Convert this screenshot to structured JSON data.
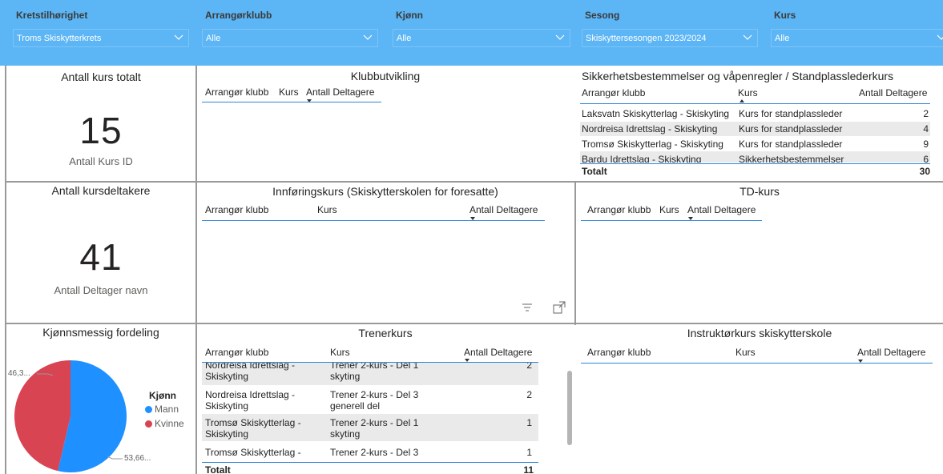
{
  "colors": {
    "filterbar": "#5cb5f5",
    "accent": "#2f86d6",
    "mann": "#1e90ff",
    "kvinne": "#d84452"
  },
  "slicers": [
    {
      "title": "Kretstilhørighet",
      "value": "Troms Skiskytterkrets"
    },
    {
      "title": "Arrangørklubb",
      "value": "Alle"
    },
    {
      "title": "Kjønn",
      "value": "Alle"
    },
    {
      "title": "Sesong",
      "value": "Skiskyttersesongen 2023/2024"
    },
    {
      "title": "Kurs",
      "value": "Alle"
    }
  ],
  "cards": {
    "kurs": {
      "title": "Antall kurs totalt",
      "value": "15",
      "label": "Antall Kurs ID"
    },
    "deltakere": {
      "title": "Antall kursdeltakere",
      "value": "41",
      "label": "Antall Deltager navn"
    }
  },
  "klubbutvikling": {
    "title": "Klubbutvikling",
    "headers": [
      "Arrangør klubb",
      "Kurs",
      "Antall Deltagere"
    ]
  },
  "sikkerhet": {
    "title": "Sikkerhetsbestemmelser og våpenregler / Standplasslederkurs",
    "headers": [
      "Arrangør klubb",
      "Kurs",
      "Antall Deltagere"
    ],
    "rows": [
      {
        "club": "Laksvatn Skiskytterlag - Skiskyting",
        "course": "Kurs for standplassleder",
        "count": "2"
      },
      {
        "club": "Nordreisa Idrettslag - Skiskyting",
        "course": "Kurs for standplassleder",
        "count": "4"
      },
      {
        "club": "Tromsø Skiskytterlag - Skiskyting",
        "course": "Kurs for standplassleder",
        "count": "9"
      },
      {
        "club": "Bardu Idrettslag - Skiskyting",
        "course": "Sikkerhetsbestemmelser",
        "count": "6"
      }
    ],
    "total_label": "Totalt",
    "total": "30"
  },
  "innforing": {
    "title": "Innføringskurs (Skiskytterskolen for foresatte)",
    "headers": [
      "Arrangør klubb",
      "Kurs",
      "Antall Deltagere"
    ]
  },
  "td": {
    "title": "TD-kurs",
    "headers": [
      "Arrangør klubb",
      "Kurs",
      "Antall Deltagere"
    ]
  },
  "kjonn": {
    "title": "Kjønnsmessig fordeling",
    "legend_title": "Kjønn",
    "label_kvinne": "46,3...",
    "label_mann": "53,66..."
  },
  "chart_data": {
    "type": "pie",
    "title": "Kjønnsmessig fordeling",
    "legend_title": "Kjønn",
    "categories": [
      "Mann",
      "Kvinne"
    ],
    "values": [
      53.66,
      46.34
    ],
    "colors": [
      "#1e90ff",
      "#d84452"
    ],
    "legend_position": "right"
  },
  "trener": {
    "title": "Trenerkurs",
    "headers": [
      "Arrangør klubb",
      "Kurs",
      "Antall Deltagere"
    ],
    "rows": [
      {
        "club1": "Nordreisa Idrettslag -",
        "club2": "Skiskyting",
        "course1": "Trener 2-kurs - Del 1",
        "course2": "skyting",
        "count": "2"
      },
      {
        "club1": "Nordreisa Idrettslag -",
        "club2": "Skiskyting",
        "course1": "Trener 2-kurs - Del 3",
        "course2": "generell del",
        "count": "2"
      },
      {
        "club1": "Tromsø Skiskytterlag -",
        "club2": "Skiskyting",
        "course1": "Trener 2-kurs - Del 1",
        "course2": "skyting",
        "count": "1"
      },
      {
        "club1": "Tromsø Skiskytterlag -",
        "club2": "",
        "course1": "Trener 2-kurs - Del 3",
        "course2": "",
        "count": "1"
      }
    ],
    "total_label": "Totalt",
    "total": "11"
  },
  "instruktor": {
    "title": "Instruktørkurs skiskytterskole",
    "headers": [
      "Arrangør klubb",
      "Kurs",
      "Antall Deltagere"
    ]
  }
}
